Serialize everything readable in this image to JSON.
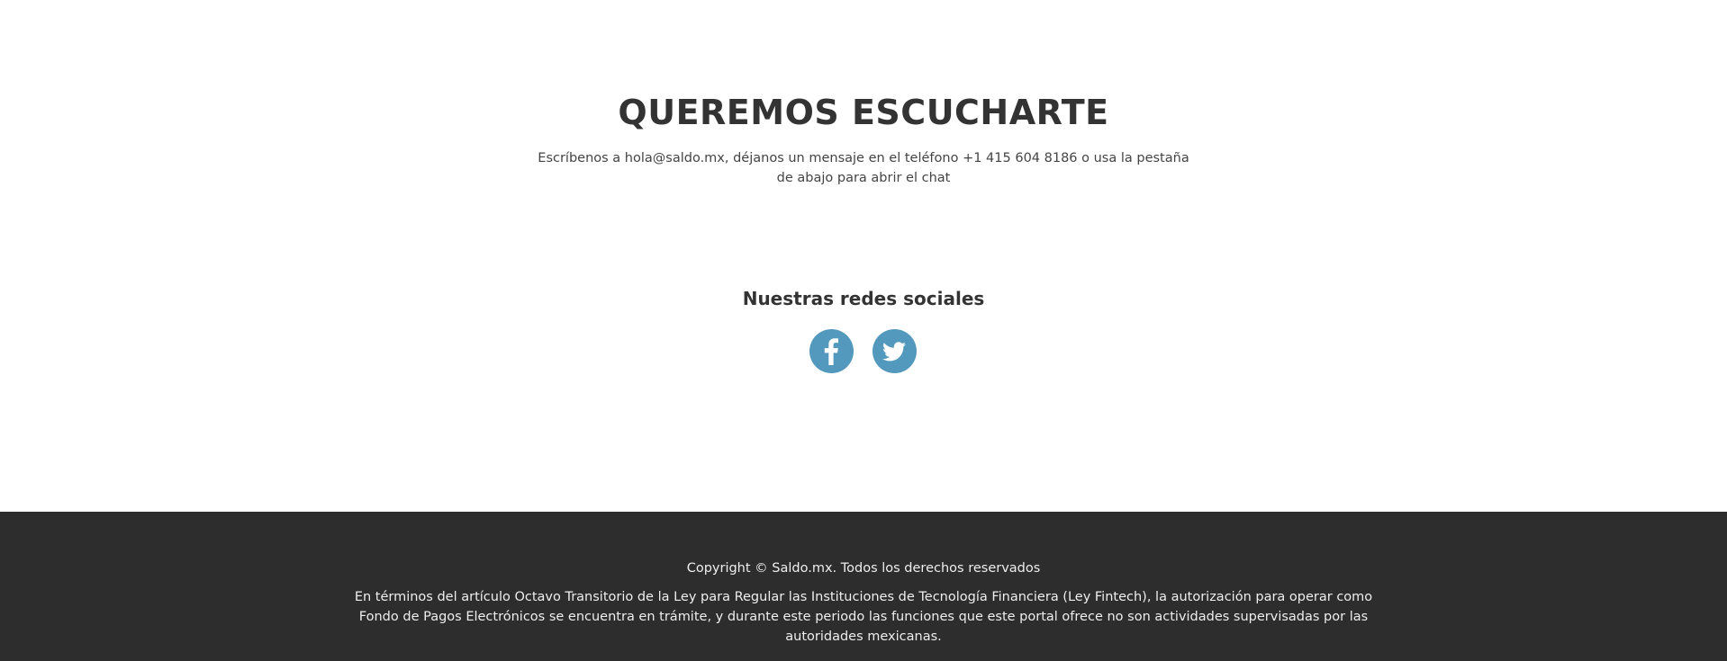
{
  "contact": {
    "title": "QUEREMOS ESCUCHARTE",
    "text": "Escríbenos a hola@saldo.mx, déjanos un mensaje en el teléfono +1 415 604 8186 o usa la pestaña de abajo para abrir el chat"
  },
  "social": {
    "title": "Nuestras redes sociales",
    "items": [
      {
        "name": "facebook",
        "icon": "facebook-icon"
      },
      {
        "name": "twitter",
        "icon": "twitter-icon"
      }
    ],
    "icon_color": "#5399bd"
  },
  "footer": {
    "copyright": "Copyright © Saldo.mx. Todos los derechos reservados",
    "legal": "En términos del artículo Octavo Transitorio de la Ley para Regular las Instituciones de Tecnología Financiera (Ley Fintech), la autorización para operar como Fondo de Pagos Electrónicos se encuentra en trámite, y durante este periodo las funciones que este portal ofrece no son actividades supervisadas por las autoridades mexicanas.",
    "background": "#2d2d2d"
  }
}
